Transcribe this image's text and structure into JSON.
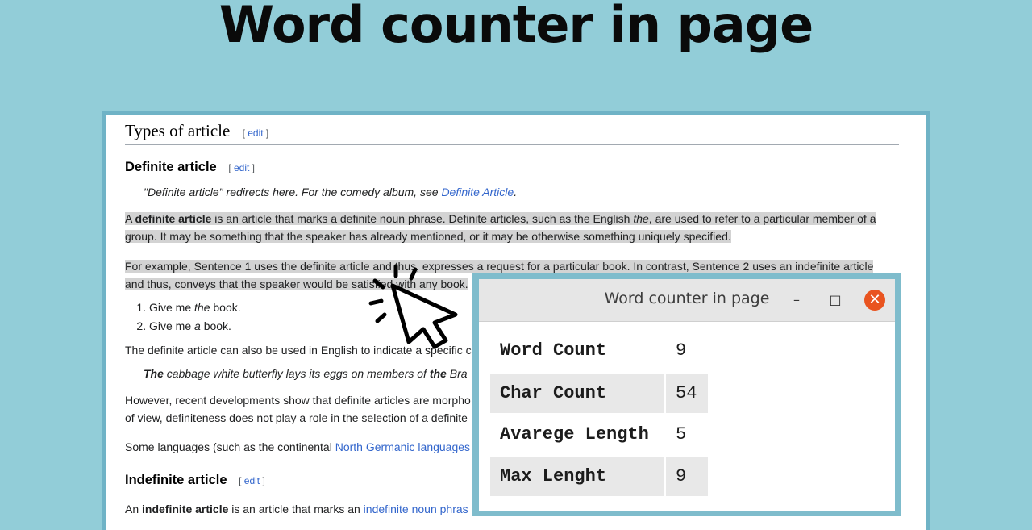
{
  "banner": {
    "title": "Word counter in page"
  },
  "wiki": {
    "section_title": "Types of article",
    "edit_label": "edit",
    "definite": {
      "heading": "Definite article",
      "hatnote_text": "\"Definite article\" redirects here. For the comedy album, see ",
      "hatnote_link": "Definite Article",
      "p1_a": "A ",
      "p1_b": "definite article",
      "p1_c": " is an article that marks a definite noun phrase. Definite articles, such as the English ",
      "p1_d": "the",
      "p1_e": ", are used to refer to a particular member of a",
      "p1_line2": "group. It may be something that the speaker has already mentioned, or it may be otherwise something uniquely specified.",
      "p2_line1": "For example, Sentence 1 uses the definite article and thus, expresses a request for a particular book. In contrast, Sentence 2 uses an indefinite article",
      "p2_line2": "and thus, conveys that the speaker would be satisfied with any book.",
      "list": [
        {
          "a": "Give me ",
          "em": "the",
          "b": " book."
        },
        {
          "a": "Give me ",
          "em": "a",
          "b": " book."
        }
      ],
      "p3": "The definite article can also be used in English to indicate a specific c",
      "quote_a": "The",
      "quote_b": " cabbage white butterfly lays its eggs on members of ",
      "quote_c": "the",
      "quote_d": " Bra",
      "p4_line1": "However, recent developments show that definite articles are morpho",
      "p4_line2": "of view, definiteness does not play a role in the selection of a definite",
      "p5_a": "Some languages (such as the continental ",
      "p5_link": "North Germanic languages"
    },
    "indefinite": {
      "heading": "Indefinite article",
      "p1_a": "An ",
      "p1_b": "indefinite article",
      "p1_c": " is an article that marks an ",
      "p1_link": "indefinite noun phras"
    }
  },
  "counter_window": {
    "title": "Word counter in page",
    "minimize_icon": "–",
    "maximize_icon": "□",
    "close_icon": "✕",
    "rows": [
      {
        "label": "Word Count",
        "value": "9"
      },
      {
        "label": "Char Count",
        "value": "54"
      },
      {
        "label": "Avarege Length",
        "value": "5"
      },
      {
        "label": "Max Lenght",
        "value": "9"
      }
    ]
  },
  "colors": {
    "background": "#92cdd8",
    "close": "#e95420",
    "link": "#3366cc",
    "highlight": "#d3d3d3"
  }
}
